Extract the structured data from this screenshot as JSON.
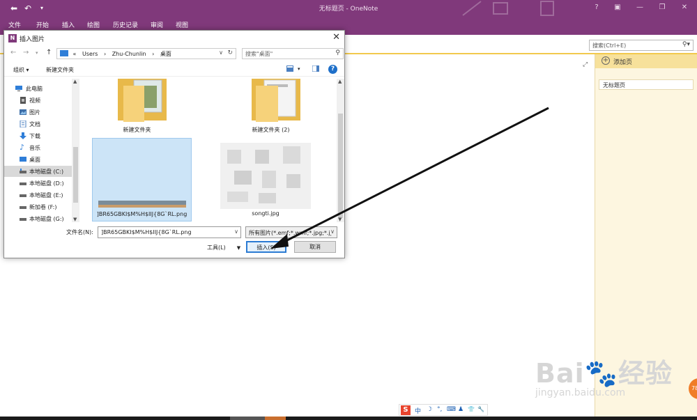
{
  "app": {
    "window_title": "无标题页 - OneNote",
    "ribbon_tabs": [
      "文件",
      "开始",
      "插入",
      "绘图",
      "历史记录",
      "审阅",
      "视图"
    ],
    "search_placeholder": "搜索(Ctrl+E)",
    "help_label": "?",
    "page_pane": {
      "add_page_label": "添加页",
      "pages": [
        "无标题页"
      ]
    }
  },
  "dialog": {
    "title": "插入图片",
    "path_segments": [
      "«",
      "Users",
      "›",
      "Zhu-Chunlin",
      "›",
      "桌面"
    ],
    "search_placeholder": "搜索\"桌面\"",
    "toolbar": {
      "organize_label": "组织 ▾",
      "new_folder_label": "新建文件夹"
    },
    "nav_items": [
      {
        "label": "此电脑",
        "icon": "computer-icon"
      },
      {
        "label": "视频",
        "icon": "video-icon"
      },
      {
        "label": "图片",
        "icon": "pictures-icon"
      },
      {
        "label": "文档",
        "icon": "document-icon"
      },
      {
        "label": "下载",
        "icon": "download-icon"
      },
      {
        "label": "音乐",
        "icon": "music-icon"
      },
      {
        "label": "桌面",
        "icon": "desktop-icon"
      },
      {
        "label": "本地磁盘 (C:)",
        "icon": "drive-icon",
        "selected": true
      },
      {
        "label": "本地磁盘 (D:)",
        "icon": "drive-icon"
      },
      {
        "label": "本地磁盘 (E:)",
        "icon": "drive-icon"
      },
      {
        "label": "新加卷 (F:)",
        "icon": "drive-icon"
      },
      {
        "label": "本地磁盘 (G:)",
        "icon": "drive-icon"
      }
    ],
    "files": [
      {
        "name": "新建文件夹",
        "kind": "folder"
      },
      {
        "name": "新建文件夹 (2)",
        "kind": "folder"
      },
      {
        "name": "]BR65GBKI$M%H$IIJ{8G`RL.png",
        "kind": "image",
        "selected": true
      },
      {
        "name": "songti.jpg",
        "kind": "image"
      }
    ],
    "filename_label": "文件名(N):",
    "filename_value": "]BR65GBKI$M%H$IIJ{8G`RL.png",
    "filetype_value": "所有图片(*.emf;*.wmf;*.jpg;*.jp",
    "tools_label": "工具(L)",
    "insert_label": "插入(S)",
    "cancel_label": "取消"
  },
  "ime_toolbar": {
    "items": [
      "S",
      "中",
      "☽",
      "°,",
      "⌨",
      "♟",
      "👕",
      "🔧"
    ]
  },
  "watermark": {
    "main": "Bai🐾经验",
    "sub": "jingyan.baidu.com"
  },
  "badge_text": "78",
  "colors": {
    "onenote_purple": "#80397b",
    "selection_blue": "#cce4f7",
    "accent_blue": "#2b7bd3",
    "page_pane_bg": "#fdf6e0"
  }
}
